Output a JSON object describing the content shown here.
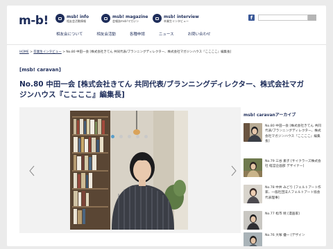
{
  "header": {
    "logo": "m-b!",
    "nav": [
      {
        "title": "msb! info",
        "subtitle": "相友会活動情報"
      },
      {
        "title": "msb! magazine",
        "subtitle": "会報誌msb!マガジン"
      },
      {
        "title": "msb! interview",
        "subtitle": "卒業生インタビュー"
      }
    ],
    "search_placeholder": ""
  },
  "mainnav": [
    "相友会について",
    "相友会活動",
    "各種申請",
    "ニュース",
    "お問い合わせ"
  ],
  "breadcrumb": {
    "home": "HOME",
    "sep1": " > ",
    "interviews": "卒業生インタビュー",
    "current": " > No.80 中田一会 [株式会社きてん 共同代表/ブランニングディレクター、株式会社マガジンハウス『ここここ』編集長]"
  },
  "category": "[msb! caravan]",
  "title": "No.80 中田一会 [株式会社きてん 共同代表/ブランニングディレクター、株式会社マガジンハウス『ここここ』編集長]",
  "slider": {
    "dot_count": 5,
    "active_dot": 0
  },
  "sidebar": {
    "heading": "msb! caravanアーカイブ",
    "items": [
      {
        "caption": "No.80 中田一会 [株式会社きてん 共同代表/ブランニングディレクター、株式会社マガジンハウス『ここここ』編集長]"
      },
      {
        "caption": "No.79 三谷 素子 [サイクラーズ株式会社 経営企画部 デザイナー]"
      },
      {
        "caption": "No.78 中井 みどり [フェルトアート作家、一般社団法人フェルトアート協会代表理事]"
      },
      {
        "caption": "No.77 松市 暁 [漫画家]"
      },
      {
        "caption": "No.76 大塚 優一 [デザイン"
      }
    ]
  },
  "colors": {
    "navy": "#1e2d5a",
    "facebook": "#3b5998",
    "dot_active": "#5a9ec9"
  }
}
